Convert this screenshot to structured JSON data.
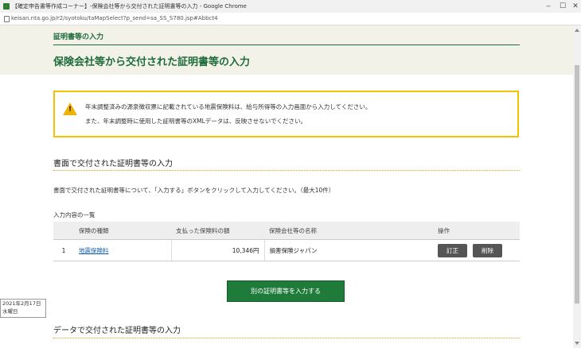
{
  "browser": {
    "window_title": "【確定申告書等作成コーナー】-保険会社等から交付された証明書等の入力 - Google Chrome",
    "url": "keisan.nta.go.jp/r2/syotoku/taMapSelect?p_send=sa_SS_S780.jsp#Abbct4",
    "controls": {
      "minimize": "‒",
      "maximize": "☐",
      "close": "✕"
    }
  },
  "header": {
    "breadcrumb": "証明書等の入力",
    "page_title": "保険会社等から交付された証明書等の入力"
  },
  "notice": {
    "icon": "warning-icon",
    "line1": "年末調整済みの源泉徴収票に記載されている地震保険料は、給与所得等の入力画面から入力してください。",
    "line2": "また、年末調整時に使用した証明書等のXMLデータは、反映させないでください。"
  },
  "paper_section": {
    "title": "書面で交付された証明書等の入力",
    "description": "書面で交付された証明書等について、「入力する」ボタンをクリックして入力してください。（最大10件）",
    "list_caption": "入力内容の一覧",
    "columns": [
      "",
      "保険の種類",
      "支払った保険料の額",
      "保険会社等の名称",
      "操作"
    ],
    "rows": [
      {
        "no": "1",
        "kind": "地震保険料",
        "amount": "10,346円",
        "company": "損害保険ジャパン",
        "edit": "訂正",
        "delete": "削除"
      }
    ],
    "add_button": "別の証明書等を入力する"
  },
  "data_section": {
    "title": "データで交付された証明書等の入力"
  },
  "date_tooltip": {
    "date": "2021年2月17日",
    "weekday": "水曜日"
  },
  "colors": {
    "brand_green": "#1e6b3a",
    "warning_yellow": "#f0c400",
    "button_green": "#1e7b3a"
  }
}
